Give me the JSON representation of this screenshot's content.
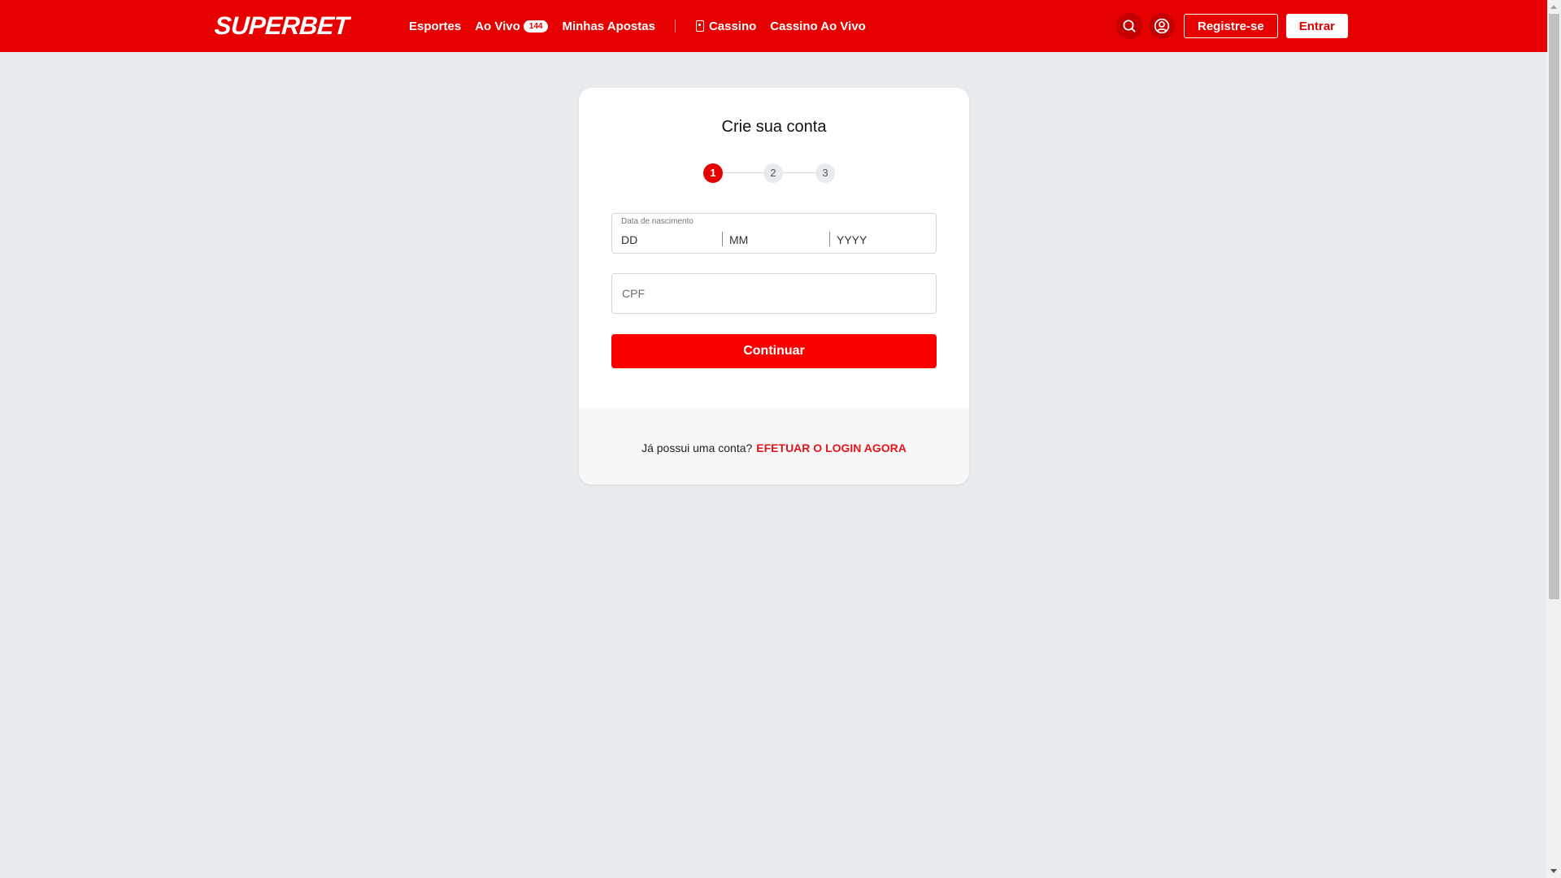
{
  "header": {
    "logo": "SUPERBET",
    "nav": [
      {
        "label": "Esportes"
      },
      {
        "label": "Ao Vivo",
        "badge": "144"
      },
      {
        "label": "Minhas Apostas"
      },
      {
        "label": "Cassino",
        "icon": "casino-card-icon"
      },
      {
        "label": "Cassino Ao Vivo"
      }
    ],
    "search_icon": "search-icon",
    "account_icon": "user-circle-icon",
    "register_label": "Registre-se",
    "login_label": "Entrar"
  },
  "signup": {
    "title": "Crie sua conta",
    "steps": [
      "1",
      "2",
      "3"
    ],
    "current_step": 1,
    "dob": {
      "label": "Data de nascimento",
      "day_placeholder": "DD",
      "month_placeholder": "MM",
      "year_placeholder": "YYYY"
    },
    "cpf_placeholder": "CPF",
    "continue_label": "Continuar",
    "footer_text": "Já possui uma conta?",
    "footer_link": "EFETUAR O LOGIN AGORA"
  },
  "colors": {
    "brand_red": "#e60000",
    "button_red": "#fa0000",
    "page_background": "#e8ebee"
  }
}
